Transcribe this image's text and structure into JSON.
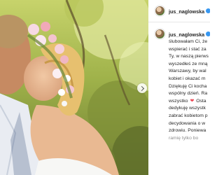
{
  "post": {
    "username": "jus_naglowska",
    "verified": true,
    "image_alt": "Wedding photo: couple kissing, bride wearing a flower crown, trees and sky behind"
  },
  "caption": {
    "lines": [
      "ślubowałam Ci, że",
      "wspierać i stać za",
      "Ty, w naszą pierws",
      "wyszedłeś ze mną",
      "Warszawy, by wal",
      "kobiet i okazać m",
      "Dziękuję Ci kocha",
      "wspólny dzień. Ra",
      "wszystko",
      "Osta",
      "dedykuję wszystk",
      "zabrać kobietom p",
      "decydowania o w",
      "zdrowiu. Poniewa",
      "ramię tylko bo"
    ]
  },
  "colors": {
    "text": "#262626",
    "verified": "#3897f0",
    "heart": "#ed4956"
  },
  "icons": {
    "verified": "verified-badge-icon",
    "heart": "red-heart-icon",
    "next": "chevron-right-icon"
  }
}
